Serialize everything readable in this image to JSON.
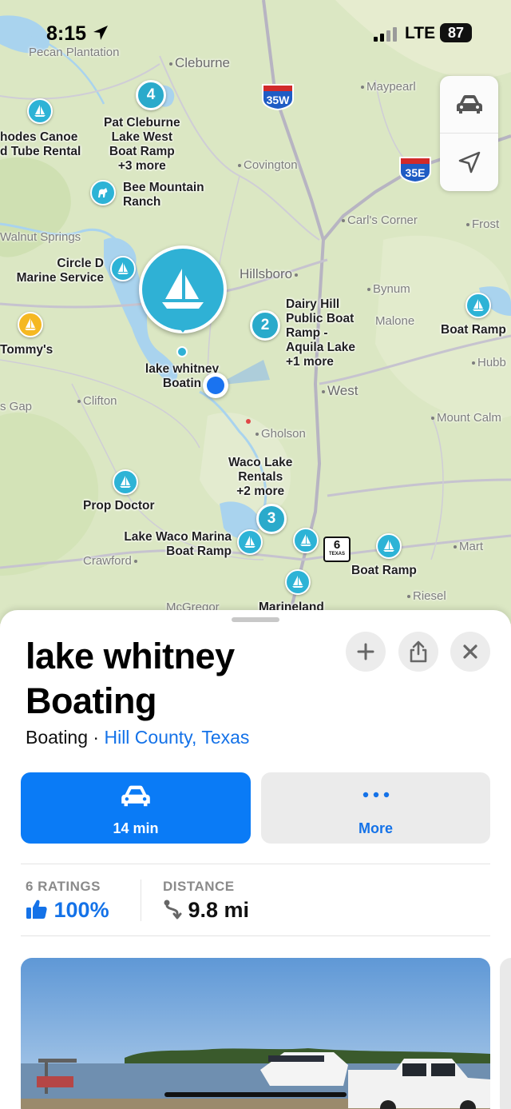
{
  "status_bar": {
    "time": "8:15",
    "network": "LTE",
    "battery": "87"
  },
  "map": {
    "towns": {
      "pecan_plantation": "Pecan Plantation",
      "cleburne": "Cleburne",
      "maypearl": "Maypearl",
      "covington": "Covington",
      "carls_corner": "Carl's Corner",
      "frost": "Frost",
      "walnut_springs": "Walnut Springs",
      "hillsboro": "Hillsboro",
      "bynum": "Bynum",
      "malone": "Malone",
      "hubbard": "Hubb",
      "gap": "s Gap",
      "clifton": "Clifton",
      "west": "West",
      "mount_calm": "Mount Calm",
      "gholson": "Gholson",
      "crawford": "Crawford",
      "mart": "Mart",
      "riesel": "Riesel",
      "mcgregor": "McGregor"
    },
    "places": {
      "rhodes_canoe": "hodes Canoe\nd Tube Rental",
      "pat_cleburne": "Pat Cleburne\nLake West\nBoat Ramp\n+3 more",
      "bee_mountain": "Bee Mountain\nRanch",
      "circle_d": "Circle D\nMarine Service",
      "tommys": "Tommy's",
      "dairy_hill": "Dairy Hill\nPublic Boat\nRamp -\nAquila Lake\n+1 more",
      "boat_ramp_east": "Boat Ramp",
      "selected": "lake whitney\nBoatin",
      "waco_lake_rentals": "Waco Lake\nRentals\n+2 more",
      "prop_doctor": "Prop Doctor",
      "lake_waco_marina": "Lake Waco Marina\nBoat Ramp",
      "boat_ramp_south": "Boat Ramp",
      "marineland": "Marineland"
    },
    "clusters": {
      "c1": "4",
      "c2": "2",
      "c3": "3"
    },
    "highways": {
      "i35w": "35W",
      "i35e": "35E",
      "tx6": "6",
      "tx6_sub": "TEXAS"
    }
  },
  "sheet": {
    "title": "lake whitney Boating",
    "category": "Boating",
    "separator": " · ",
    "location": "Hill County, Texas",
    "drive_time": "14 min",
    "more_label": "More",
    "ratings_header": "6 RATINGS",
    "ratings_value": "100%",
    "distance_header": "DISTANCE",
    "distance_value": "9.8 mi"
  },
  "colors": {
    "accent": "#0a7bf6",
    "link": "#1472e8",
    "poi_teal": "#2db3d6",
    "poi_yellow": "#f5b822"
  }
}
